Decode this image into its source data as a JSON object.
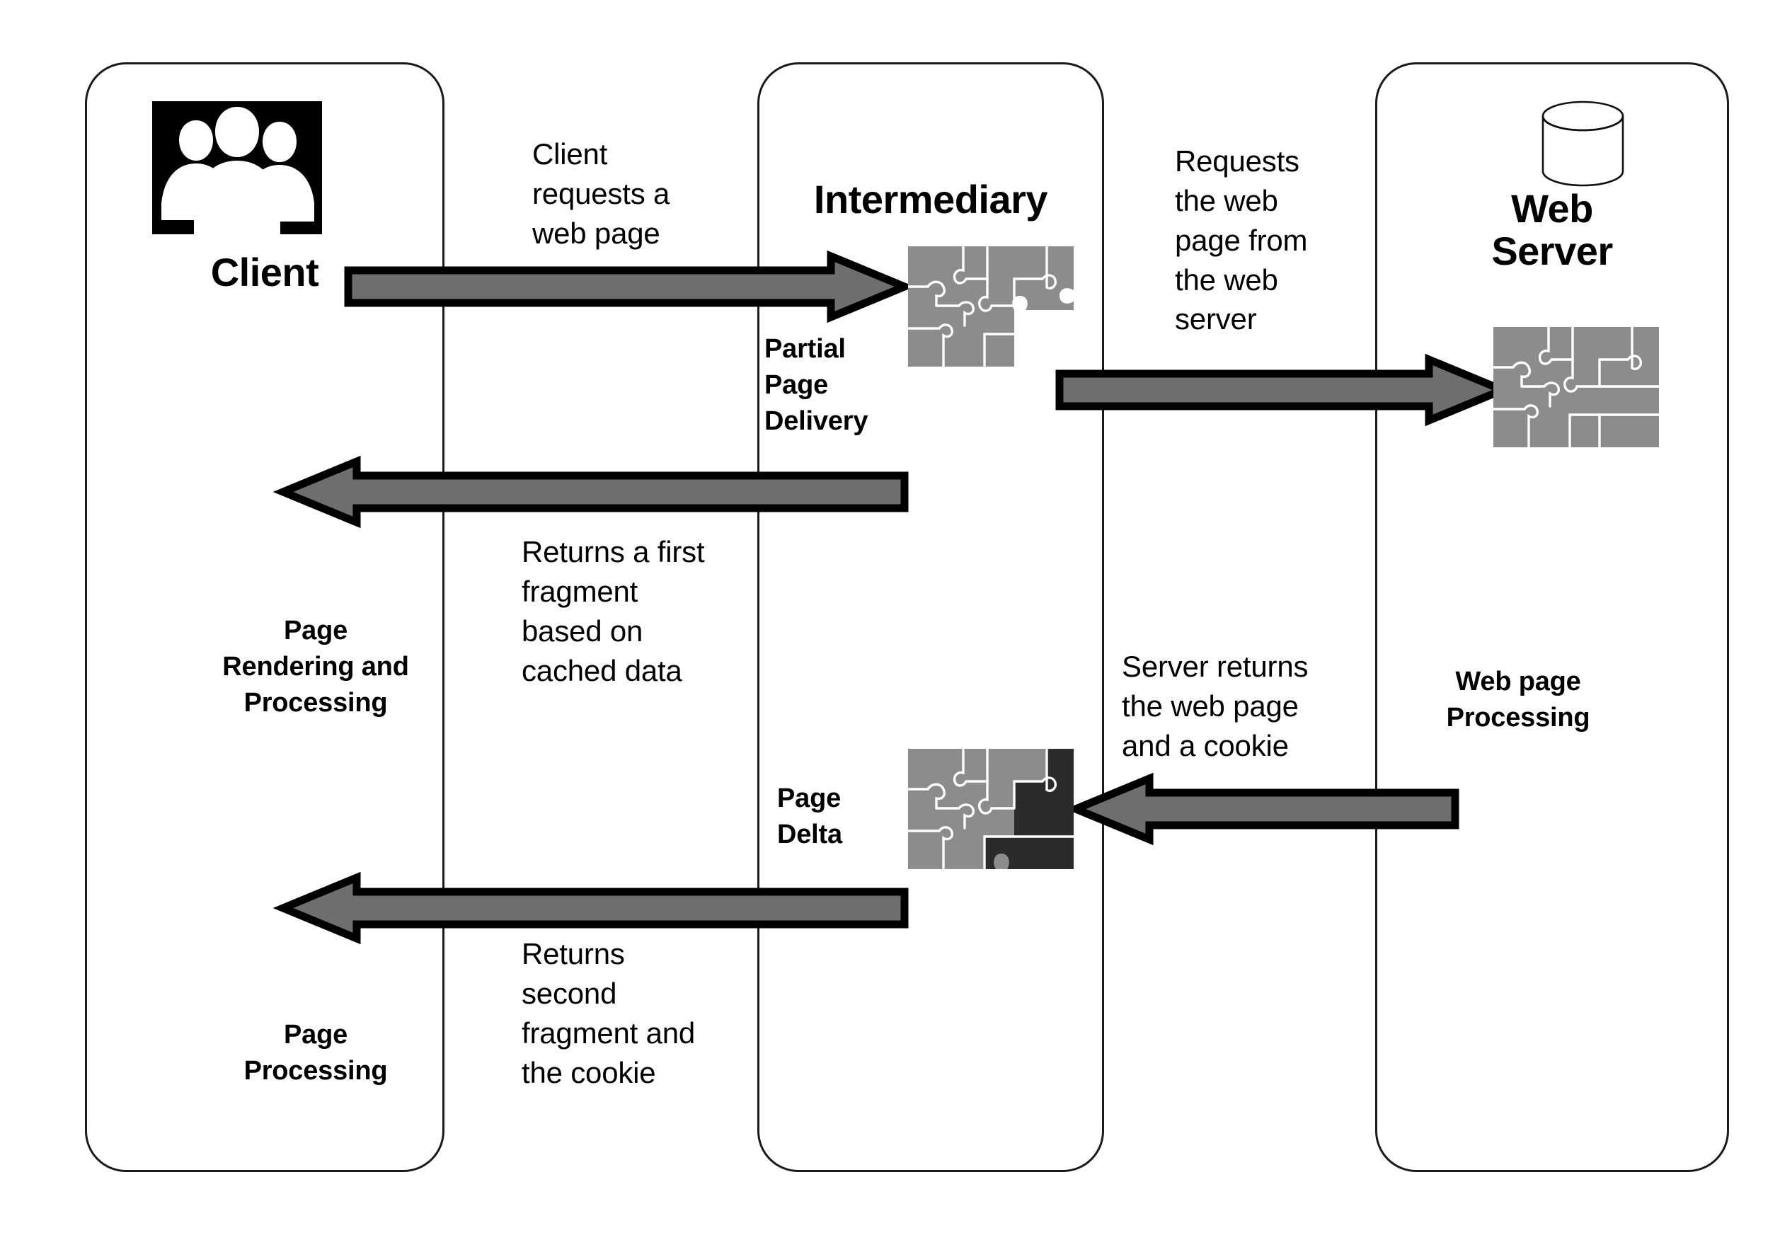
{
  "diagram": {
    "title_client": "Client",
    "title_intermediary": "Intermediary",
    "title_webserver": "Web\nServer",
    "icons": {
      "client": "people-group-icon",
      "webserver": "database-cylinder-icon",
      "puzzle_partial": "puzzle-partial-icon",
      "puzzle_delta": "puzzle-delta-icon",
      "puzzle_complete": "puzzle-complete-icon"
    },
    "notes": {
      "client_request": "Client\nrequests a\nweb page",
      "requests_server": "Requests\nthe web\npage from\nthe web\nserver",
      "first_fragment": "Returns a first\nfragment\nbased on\ncached data",
      "server_returns": "Server returns\nthe web page\nand a cookie",
      "second_fragment": "Returns\nsecond\nfragment and\nthe cookie"
    },
    "labels": {
      "partial_page_delivery": "Partial\nPage\nDelivery",
      "page_delta": "Page\nDelta",
      "page_rendering_processing": "Page\nRendering and\nProcessing",
      "page_processing": "Page\nProcessing",
      "webpage_processing": "Web page\nProcessing"
    },
    "colors": {
      "arrow_fill": "#6e6e6e",
      "arrow_stroke": "#000000",
      "lane_stroke": "#1a1a1a",
      "puzzle_fill": "#8c8c8c",
      "puzzle_dark": "#2b2b2b",
      "icon_black": "#000000",
      "background": "#ffffff"
    }
  }
}
